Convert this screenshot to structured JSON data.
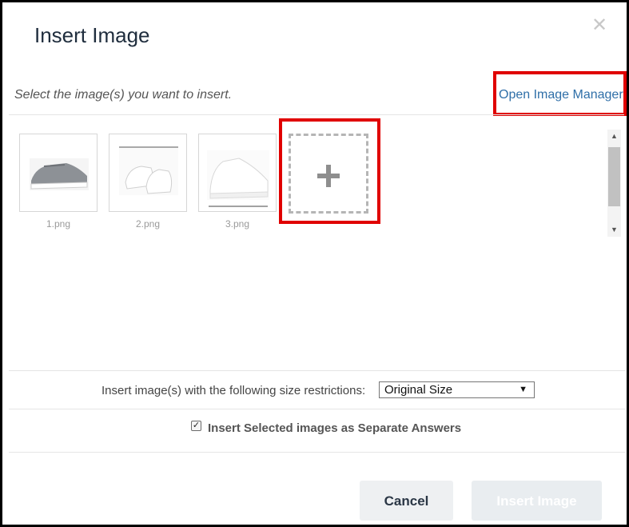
{
  "dialog": {
    "title": "Insert Image",
    "close_glyph": "✕",
    "instruction": "Select the image(s) you want to insert.",
    "manager_link": "Open Image Manager"
  },
  "images": [
    {
      "label": "1.png",
      "icon": "gray-sneaker-image"
    },
    {
      "label": "2.png",
      "icon": "white-sneakers-image"
    },
    {
      "label": "3.png",
      "icon": "white-sneaker-image"
    }
  ],
  "add_tile": {
    "icon": "plus-icon"
  },
  "size": {
    "label": "Insert image(s) with the following size restrictions:",
    "selected": "Original Size"
  },
  "separate": {
    "checked": true,
    "label": "Insert Selected images as Separate Answers"
  },
  "buttons": {
    "cancel": "Cancel",
    "insert": "Insert Image"
  },
  "colors": {
    "highlight": "#e00000",
    "link": "#2f6fa8",
    "title": "#1f2d3d",
    "disabled_button": "#e9edf0"
  }
}
